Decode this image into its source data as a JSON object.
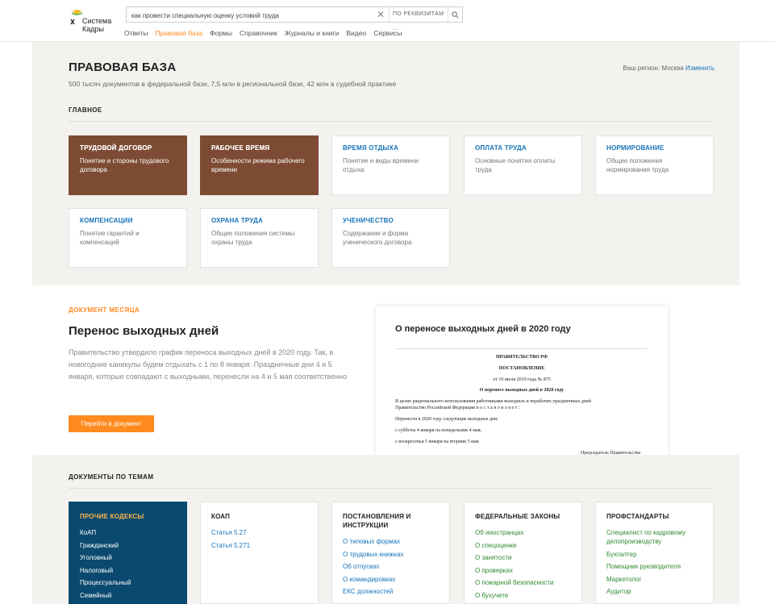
{
  "header": {
    "logo_line1": "Система",
    "logo_line2": "Кадры",
    "search_value": "как провести специальную оценку условий труда",
    "search_scope": "ПО РЕКВИЗИТАМ ...",
    "nav": [
      "Ответы",
      "Правовая база",
      "Формы",
      "Справочник",
      "Журналы и книги",
      "Видео",
      "Сервисы"
    ],
    "nav_active": "Правовая база"
  },
  "page": {
    "title": "ПРАВОВАЯ БАЗА",
    "subtitle": "500 тысяч документов в федеральной базе, 7,5 млн в региональной базе, 42 млн в судебной практике",
    "region_label": "Ваш регион: Москва",
    "region_change": "Изменить",
    "main_section": "ГЛАВНОЕ"
  },
  "tiles": [
    {
      "title": "ТРУДОВОЙ ДОГОВОР",
      "desc": "Понятие и стороны трудового договора"
    },
    {
      "title": "РАБОЧЕЕ ВРЕМЯ",
      "desc": "Особенности режима рабочего времени"
    },
    {
      "title": "ВРЕМЯ ОТДЫХА",
      "desc": "Понятие и виды времени отдыха"
    },
    {
      "title": "ОПЛАТА ТРУДА",
      "desc": "Основные понятия оплаты труда"
    },
    {
      "title": "НОРМИРОВАНИЕ",
      "desc": "Общие положения нормирования труда"
    },
    {
      "title": "КОМПЕНСАЦИИ",
      "desc": "Понятие гарантий и компенсаций"
    },
    {
      "title": "ОХРАНА ТРУДА",
      "desc": "Общие положения системы охраны труда"
    },
    {
      "title": "УЧЕНИЧЕСТВО",
      "desc": "Содержание и форма ученического договора"
    }
  ],
  "doc_month": {
    "tag": "ДОКУМЕНТ МЕСЯЦА",
    "title": "Перенос выходных дней",
    "text": "Правительство утвердило график переноса выходных дней в 2020 году. Так, в новогодние каникулы будем отдыхать с 1 по 8 января. Праздничные дни 4 и 5 января, которые совпадают с выходными, перенесли на 4 и 5 мая соответственно",
    "button": "Перейти в документ",
    "card_title": "О переносе выходных дней в 2020 году",
    "doc_lines": {
      "org": "ПРАВИТЕЛЬСТВО РФ",
      "kind": "ПОСТАНОВЛЕНИЕ",
      "date": "от 10 июля 2019 года № 875",
      "subject": "О переносе выходных дней в 2020 году",
      "p1a": "В целях рационального использования работниками выходных и нерабочих праздничных дней",
      "p1b": "Правительство Российской Федерации п о с т а н о в л я е т :",
      "p2": "Перенести в 2020 году следующие выходные дни:",
      "p3": "с субботы 4 января на понедельник 4 мая;",
      "p4": "с воскресенья 5 января на вторник 5 мая.",
      "sign": "Председатель Правительства"
    }
  },
  "topics": {
    "section": "ДОКУМЕНТЫ ПО ТЕМАМ",
    "columns": [
      {
        "title": "ПРОЧИЕ КОДЕКСЫ",
        "items": [
          "КоАП",
          "Гражданский",
          "Уголовный",
          "Налоговый",
          "Процессуальный",
          "Семейный"
        ]
      },
      {
        "title": "КОАП",
        "items": [
          "Статья 5.27",
          "Статья 5.271"
        ]
      },
      {
        "title": "ПОСТАНОВЛЕНИЯ И ИНСТРУКЦИИ",
        "items": [
          "О типовых формах",
          "О трудовых книжках",
          "Об отпусках",
          "О командировках",
          "ЕКС должностей"
        ]
      },
      {
        "title": "ФЕДЕРАЛЬНЫЕ ЗАКОНЫ",
        "items": [
          "Об иностранцах",
          "О спецоценке",
          "О занятости",
          "О проверках",
          "О пожарной безопасности",
          "О бухучете"
        ]
      },
      {
        "title": "ПРОФСТАНДАРТЫ",
        "items": [
          "Специалист по кадровому делопроизводству",
          "Бухгалтер",
          "Помощник руководителя",
          "Маркетолог",
          "Аудитор"
        ]
      }
    ]
  }
}
